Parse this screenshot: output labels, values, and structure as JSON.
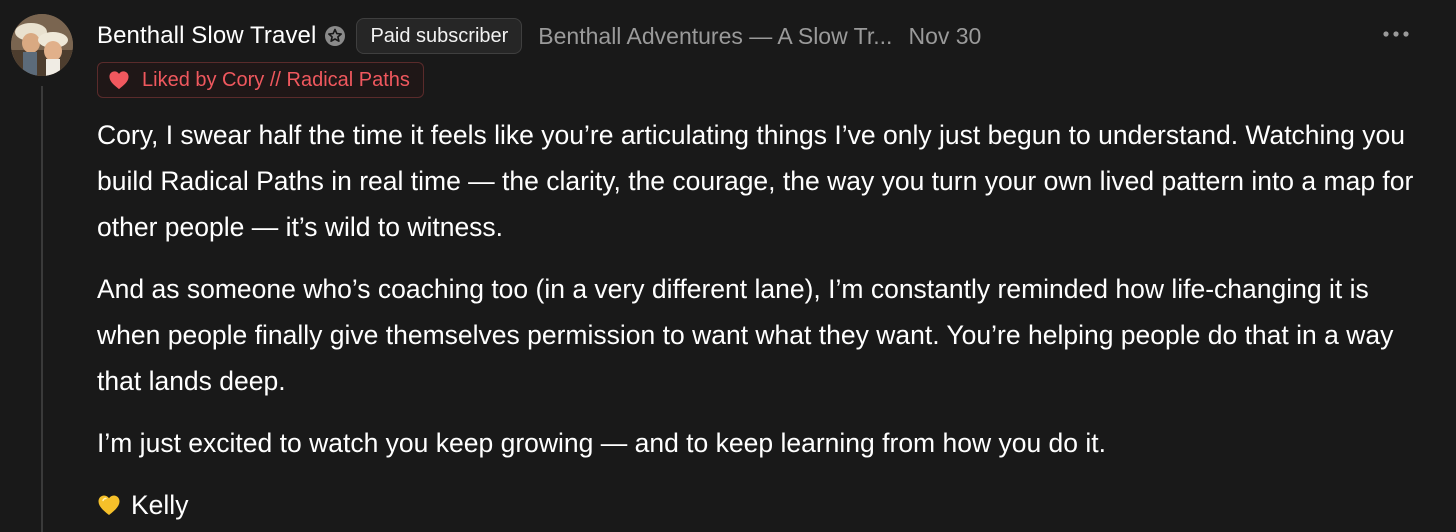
{
  "comment": {
    "author": "Benthall Slow Travel",
    "badge_label": "Paid subscriber",
    "publication": "Benthall Adventures — A Slow Tr...",
    "date": "Nov 30",
    "liked_by": "Liked by Cory // Radical Paths",
    "paragraphs": [
      "Cory, I swear half the time it feels like you’re articulating things I’ve only just begun to understand. Watching you build Radical Paths in real time — the clarity, the courage, the way you turn your own lived pattern into a map for other people — it’s wild to witness.",
      "And as someone who’s coaching too (in a very different lane), I’m constantly reminded how life-changing it is when people finally give themselves permission to want what they want. You’re helping people do that in a way that lands deep.",
      "I’m just excited to watch you keep growing — and to keep learning from how you do it."
    ],
    "signature_name": "Kelly",
    "signature_emoji": "yellow-heart-icon"
  },
  "icons": {
    "more": "more-horizontal-icon",
    "badge": "subscriber-badge-icon",
    "heart": "heart-icon"
  },
  "colors": {
    "background": "#191919",
    "liked_accent": "#f0585e",
    "muted_text": "#9a9a9a",
    "yellow_heart": "#f5c02a"
  }
}
